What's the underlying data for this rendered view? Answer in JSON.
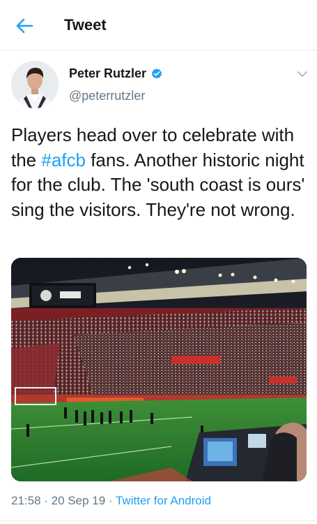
{
  "header": {
    "title": "Tweet",
    "back_icon": "arrow-left-icon"
  },
  "tweet": {
    "author": {
      "name": "Peter Rutzler",
      "handle": "@peterrutzler",
      "verified": true
    },
    "text_before": "Players head over to celebrate with the ",
    "hashtag": "#afcb",
    "text_after": " fans. Another historic night for the club. The 'south coast is ours' sing the visitors. They're not wrong.",
    "media_description": "stadium-photo",
    "time": "21:58",
    "separator": " · ",
    "date": "20 Sep 19",
    "source": "Twitter for Android"
  },
  "colors": {
    "accent": "#1da1f2",
    "text": "#14171a",
    "secondary": "#657786",
    "divider": "#e6ecf0"
  }
}
